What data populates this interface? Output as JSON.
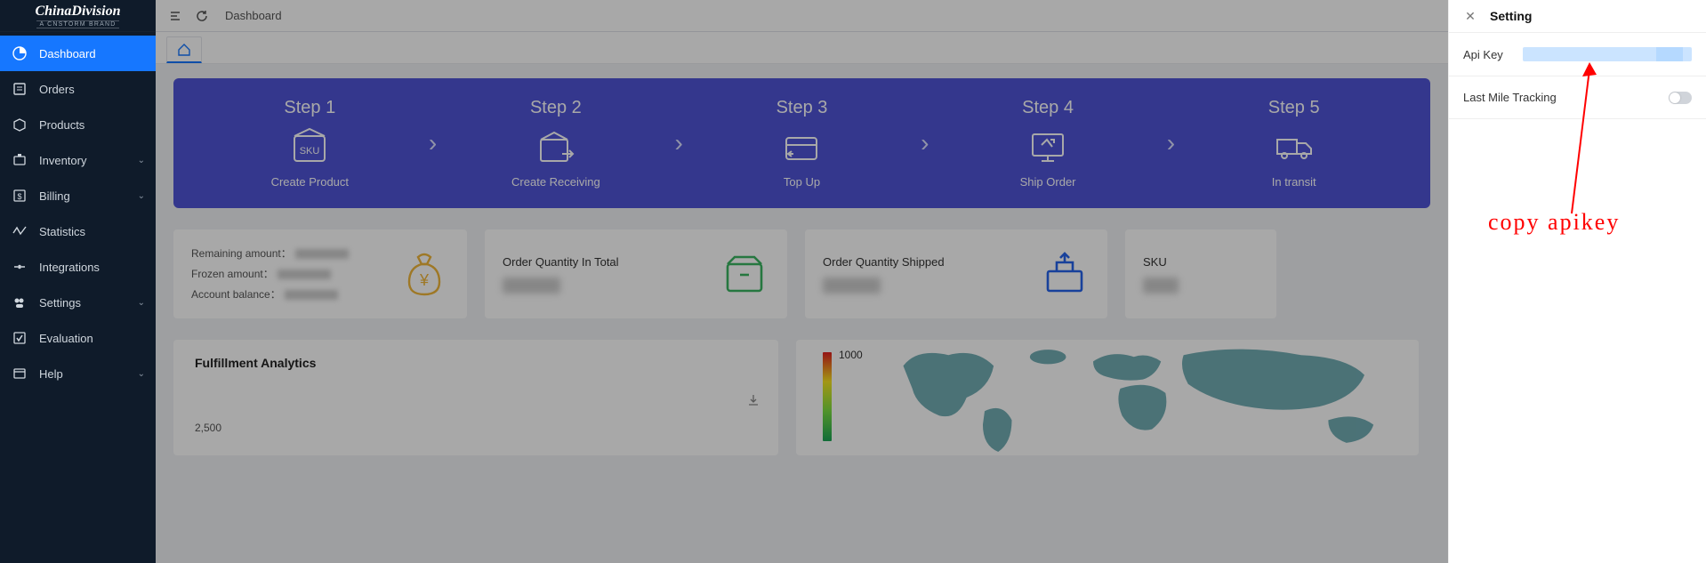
{
  "brand": {
    "name": "ChinaDivision",
    "subtitle": "A CNSTORM BRAND"
  },
  "sidebar": {
    "items": [
      {
        "label": "Dashboard",
        "active": true
      },
      {
        "label": "Orders"
      },
      {
        "label": "Products"
      },
      {
        "label": "Inventory",
        "expandable": true
      },
      {
        "label": "Billing",
        "expandable": true
      },
      {
        "label": "Statistics"
      },
      {
        "label": "Integrations"
      },
      {
        "label": "Settings",
        "expandable": true
      },
      {
        "label": "Evaluation"
      },
      {
        "label": "Help",
        "expandable": true
      }
    ]
  },
  "topbar": {
    "title": "Dashboard"
  },
  "steps": [
    {
      "num": "Step 1",
      "label": "Create Product"
    },
    {
      "num": "Step 2",
      "label": "Create Receiving"
    },
    {
      "num": "Step 3",
      "label": "Top Up"
    },
    {
      "num": "Step 4",
      "label": "Ship Order"
    },
    {
      "num": "Step 5",
      "label": "In transit"
    }
  ],
  "stats": {
    "remaining_label": "Remaining amount：",
    "frozen_label": "Frozen amount：",
    "balance_label": "Account balance：",
    "total_title": "Order Quantity In Total",
    "shipped_title": "Order Quantity Shipped",
    "sku_title": "SKU"
  },
  "analytics": {
    "fulfillment_title": "Fulfillment Analytics",
    "axis_value": "2,500",
    "map_legend_max": "1000"
  },
  "panel": {
    "title": "Setting",
    "api_key_label": "Api Key",
    "tracking_label": "Last Mile Tracking"
  },
  "annotation": {
    "text": "copy apikey"
  }
}
